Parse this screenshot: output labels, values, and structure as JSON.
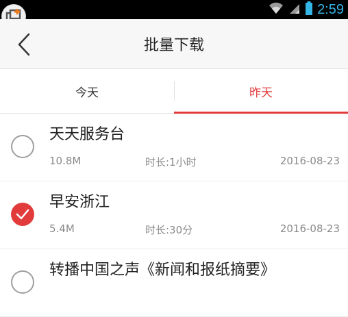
{
  "status_bar": {
    "time": "2:59"
  },
  "header": {
    "title": "批量下载"
  },
  "tabs": [
    {
      "label": "今天",
      "active": false
    },
    {
      "label": "昨天",
      "active": true
    }
  ],
  "items": [
    {
      "title": "天天服务台",
      "size": "10.8M",
      "duration": "时长:1小时",
      "date": "2016-08-23",
      "checked": false
    },
    {
      "title": "早安浙江",
      "size": "5.4M",
      "duration": "时长:30分",
      "date": "2016-08-23",
      "checked": true
    },
    {
      "title": "转播中国之声《新闻和报纸摘要》",
      "size": "",
      "duration": "",
      "date": "",
      "checked": false
    }
  ],
  "colors": {
    "accent": "#e23b3b",
    "status_time": "#33b5e5"
  }
}
